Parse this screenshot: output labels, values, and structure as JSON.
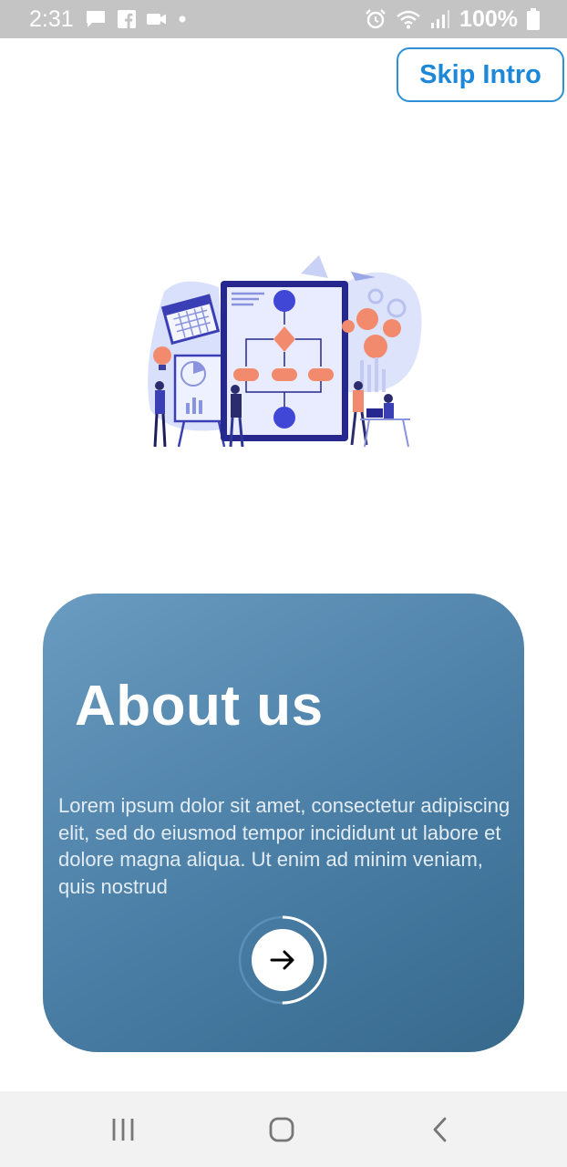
{
  "status_bar": {
    "time": "2:31",
    "notification_icons": [
      "message-icon",
      "facebook-icon",
      "video-camera-icon",
      "dot-icon"
    ],
    "system_icons": [
      "alarm-icon",
      "wifi-icon",
      "signal-icon"
    ],
    "battery": "100%"
  },
  "header": {
    "skip_label": "Skip Intro"
  },
  "hero": {
    "image": "flowchart-team-illustration"
  },
  "card": {
    "title": "About us",
    "body": "Lorem ipsum dolor sit amet, consectetur adipiscing elit, sed do eiusmod tempor incididunt ut labore et dolore magna aliqua. Ut enim ad minim veniam, quis nostrud",
    "next_icon": "arrow-right-icon",
    "progress": 0.5
  },
  "nav_bar": {
    "items": [
      "recent-apps-icon",
      "home-icon",
      "back-icon"
    ]
  },
  "colors": {
    "accent": "#1e88d8",
    "card_start": "#6a9bc0",
    "card_end": "#36698c",
    "status_bar": "#c4c4c4"
  }
}
